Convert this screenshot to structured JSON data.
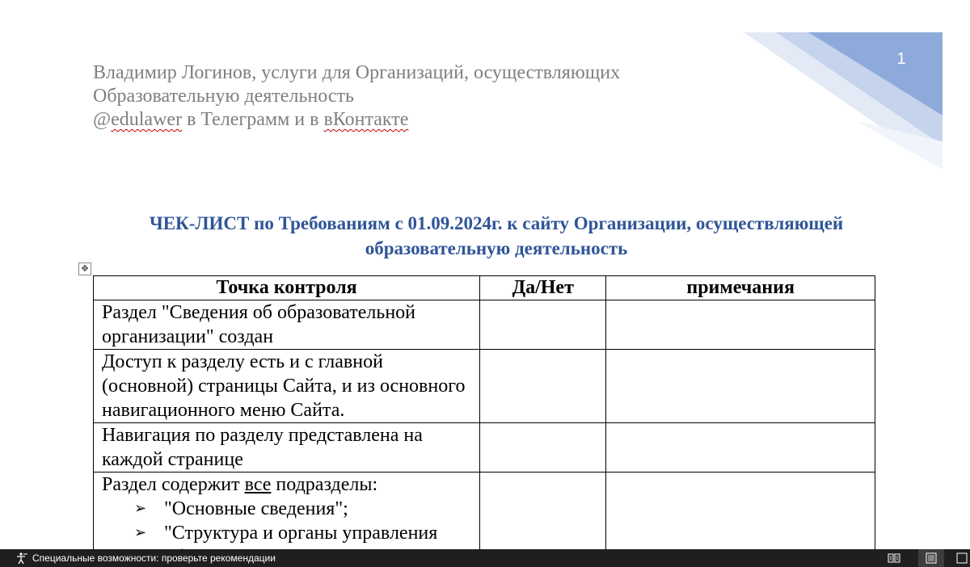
{
  "page": {
    "number": "1",
    "header_lines": [
      "Владимир Логинов, услуги для Организаций, осуществляющих",
      "Образовательную деятельность"
    ],
    "header_contact": {
      "prefix": "@",
      "handle": "edulawer",
      "middle": " в Телеграмм и в ",
      "network": "вКонтакте"
    },
    "title_lines": [
      "ЧЕК-ЛИСТ по Требованиям с 01.09.2024г. к сайту Организации, осуществляющей",
      "образовательную деятельность"
    ]
  },
  "table": {
    "headers": [
      "Точка контроля",
      "Да/Нет",
      "примечания"
    ],
    "rows": [
      {
        "text": "Раздел \"Сведения об образовательной организации\" создан"
      },
      {
        "text": "Доступ к разделу есть и с главной (основной) страницы Сайта, и из основного навигационного меню Сайта."
      },
      {
        "text": "Навигация по разделу представлена на каждой странице"
      },
      {
        "text_before": "Раздел содержит ",
        "emphasis": "все",
        "text_after": " подразделы:",
        "items": [
          "\"Основные сведения\";",
          "\"Структура и органы управления образовательной организацией\";"
        ]
      }
    ]
  },
  "statusbar": {
    "accessibility_text": "Специальные возможности: проверьте рекомендации",
    "colors": {
      "background": "#1f1f1f",
      "text": "#ffffff"
    }
  },
  "colors": {
    "title": "#2f5597",
    "header_text": "#7f7f7f",
    "corner_dark": "#8eaadb",
    "corner_light": "#dae3f3"
  }
}
